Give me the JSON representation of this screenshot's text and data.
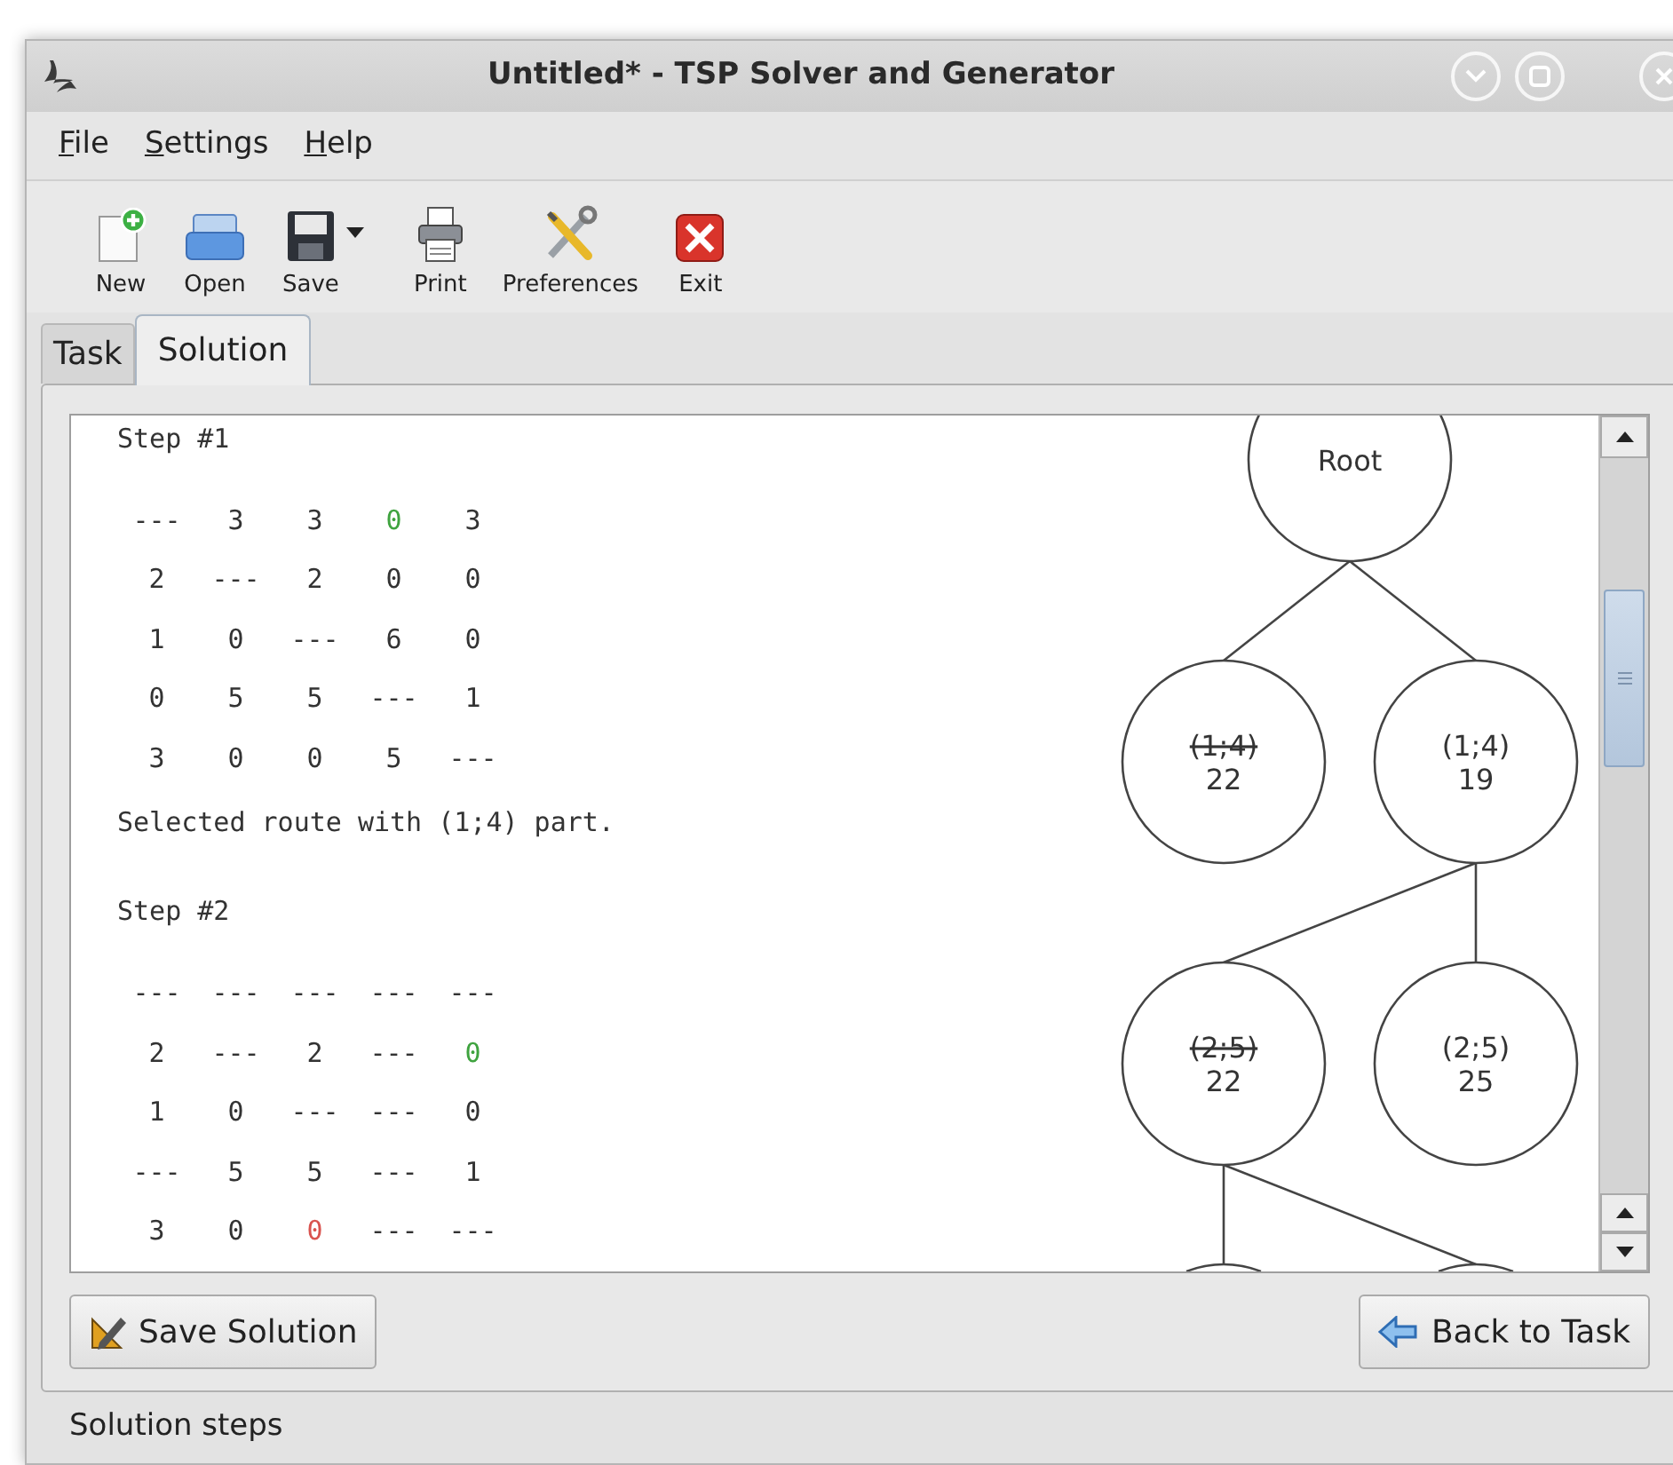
{
  "window": {
    "title": "Untitled* - TSP Solver and Generator"
  },
  "menu": [
    {
      "label": "File"
    },
    {
      "label": "Settings"
    },
    {
      "label": "Help"
    }
  ],
  "toolbar": [
    {
      "label": "New",
      "kind": "new",
      "dropdown": false
    },
    {
      "label": "Open",
      "kind": "open",
      "dropdown": false
    },
    {
      "label": "Save",
      "kind": "save",
      "dropdown": true
    },
    {
      "label": "Print",
      "kind": "print",
      "dropdown": false
    },
    {
      "label": "Preferences",
      "kind": "preferences",
      "dropdown": false
    },
    {
      "label": "Exit",
      "kind": "exit",
      "dropdown": false
    }
  ],
  "tabs": [
    {
      "label": "Task",
      "selected": false
    },
    {
      "label": "Solution",
      "selected": true
    }
  ],
  "steps": [
    {
      "title": "Step #1",
      "matrix": [
        [
          {
            "text": "---"
          },
          {
            "text": "3"
          },
          {
            "text": "3"
          },
          {
            "text": "0",
            "color": "#3fa33f"
          },
          {
            "text": "3"
          }
        ],
        [
          {
            "text": "2"
          },
          {
            "text": "---"
          },
          {
            "text": "2"
          },
          {
            "text": "0"
          },
          {
            "text": "0"
          }
        ],
        [
          {
            "text": "1"
          },
          {
            "text": "0"
          },
          {
            "text": "---"
          },
          {
            "text": "6"
          },
          {
            "text": "0"
          }
        ],
        [
          {
            "text": "0"
          },
          {
            "text": "5"
          },
          {
            "text": "5"
          },
          {
            "text": "---"
          },
          {
            "text": "1"
          }
        ],
        [
          {
            "text": "3"
          },
          {
            "text": "0"
          },
          {
            "text": "0"
          },
          {
            "text": "5"
          },
          {
            "text": "---"
          }
        ]
      ],
      "note": "Selected route with (1;4) part."
    },
    {
      "title": "Step #2",
      "matrix": [
        [
          {
            "text": "---"
          },
          {
            "text": "---"
          },
          {
            "text": "---"
          },
          {
            "text": "---"
          },
          {
            "text": "---"
          }
        ],
        [
          {
            "text": "2"
          },
          {
            "text": "---"
          },
          {
            "text": "2"
          },
          {
            "text": "---"
          },
          {
            "text": "0",
            "color": "#3fa33f"
          }
        ],
        [
          {
            "text": "1"
          },
          {
            "text": "0"
          },
          {
            "text": "---"
          },
          {
            "text": "---"
          },
          {
            "text": "0"
          }
        ],
        [
          {
            "text": "---"
          },
          {
            "text": "5"
          },
          {
            "text": "5"
          },
          {
            "text": "---"
          },
          {
            "text": "1"
          }
        ],
        [
          {
            "text": "3"
          },
          {
            "text": "0"
          },
          {
            "text": "0",
            "color": "#d9534f"
          },
          {
            "text": "---"
          },
          {
            "text": "---"
          }
        ]
      ]
    }
  ],
  "tree": {
    "kind": "node",
    "lines": [
      "Root"
    ],
    "struck": false,
    "children": [
      {
        "kind": "node",
        "lines": [
          "(1;4)",
          "22"
        ],
        "struck": true
      },
      {
        "kind": "node",
        "lines": [
          "(1;4)",
          "19"
        ],
        "struck": false,
        "children": [
          {
            "kind": "node",
            "lines": [
              "(2;5)",
              "22"
            ],
            "struck": true,
            "children": [
              {
                "kind": "offscreen"
              },
              {
                "kind": "offscreen"
              }
            ]
          },
          {
            "kind": "node",
            "lines": [
              "(2;5)",
              "25"
            ],
            "struck": false
          }
        ]
      }
    ]
  },
  "buttons": {
    "save_solution": "Save Solution",
    "back_to_task": "Back to Task"
  },
  "status_bar": "Solution steps"
}
